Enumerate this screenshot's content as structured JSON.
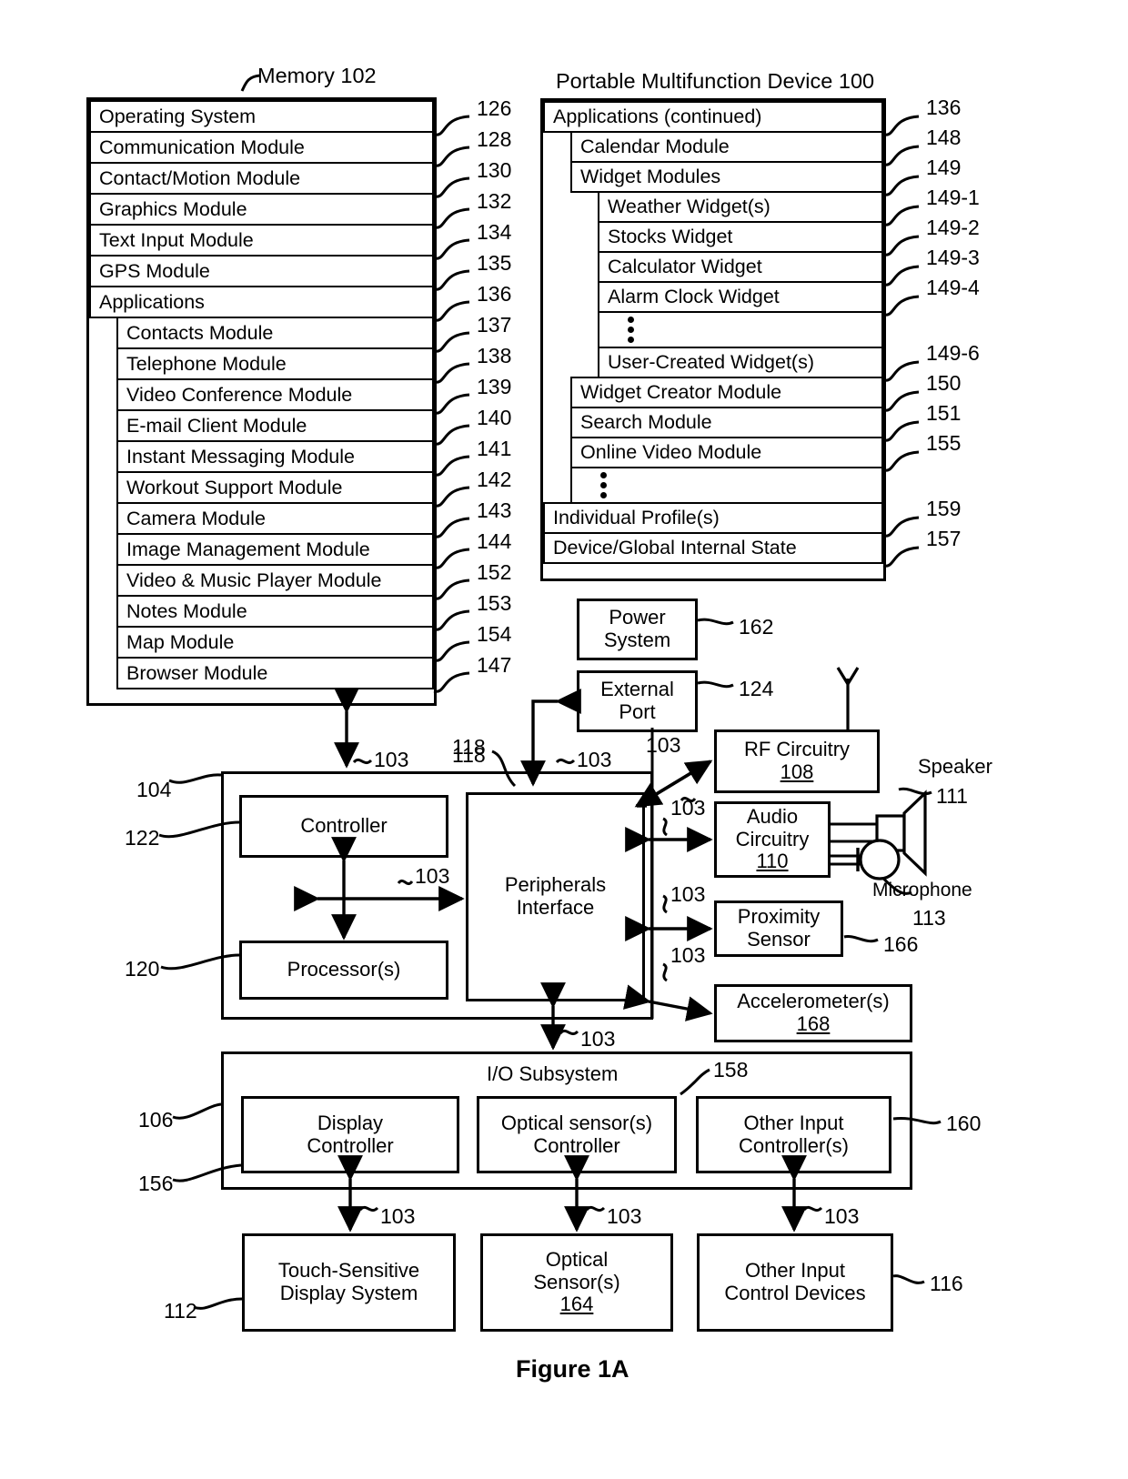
{
  "figure": {
    "caption": "Figure 1A"
  },
  "memory": {
    "title": "Memory 102",
    "rows": [
      {
        "label": "Operating System",
        "ref": "126",
        "indent": 0
      },
      {
        "label": "Communication Module",
        "ref": "128",
        "indent": 0
      },
      {
        "label": "Contact/Motion Module",
        "ref": "130",
        "indent": 0
      },
      {
        "label": "Graphics Module",
        "ref": "132",
        "indent": 0
      },
      {
        "label": "Text Input Module",
        "ref": "134",
        "indent": 0
      },
      {
        "label": "GPS Module",
        "ref": "135",
        "indent": 0
      },
      {
        "label": "Applications",
        "ref": "136",
        "indent": 0
      },
      {
        "label": "Contacts Module",
        "ref": "137",
        "indent": 1
      },
      {
        "label": "Telephone Module",
        "ref": "138",
        "indent": 1
      },
      {
        "label": "Video Conference Module",
        "ref": "139",
        "indent": 1
      },
      {
        "label": "E-mail Client Module",
        "ref": "140",
        "indent": 1
      },
      {
        "label": "Instant Messaging Module",
        "ref": "141",
        "indent": 1
      },
      {
        "label": "Workout Support Module",
        "ref": "142",
        "indent": 1
      },
      {
        "label": "Camera Module",
        "ref": "143",
        "indent": 1
      },
      {
        "label": "Image Management Module",
        "ref": "144",
        "indent": 1
      },
      {
        "label": "Video & Music Player Module",
        "ref": "152",
        "indent": 1
      },
      {
        "label": "Notes Module",
        "ref": "153",
        "indent": 1
      },
      {
        "label": "Map Module",
        "ref": "154",
        "indent": 1
      },
      {
        "label": "Browser Module",
        "ref": "147",
        "indent": 1
      }
    ]
  },
  "device": {
    "title": "Portable Multifunction Device 100",
    "rows": [
      {
        "label": "Applications (continued)",
        "ref": "136",
        "indent": 0
      },
      {
        "label": "Calendar Module",
        "ref": "148",
        "indent": 1
      },
      {
        "label": "Widget Modules",
        "ref": "149",
        "indent": 1
      },
      {
        "label": "Weather Widget(s)",
        "ref": "149-1",
        "indent": 2
      },
      {
        "label": "Stocks Widget",
        "ref": "149-2",
        "indent": 2
      },
      {
        "label": "Calculator Widget",
        "ref": "149-3",
        "indent": 2
      },
      {
        "label": "Alarm Clock Widget",
        "ref": "149-4",
        "indent": 2
      },
      {
        "label": "",
        "ref": "",
        "indent": 2,
        "ellipsis": true
      },
      {
        "label": "User-Created Widget(s)",
        "ref": "149-6",
        "indent": 2
      },
      {
        "label": "Widget Creator Module",
        "ref": "150",
        "indent": 1
      },
      {
        "label": "Search Module",
        "ref": "151",
        "indent": 1
      },
      {
        "label": "Online Video Module",
        "ref": "155",
        "indent": 1
      },
      {
        "label": "",
        "ref": "",
        "indent": 1,
        "ellipsis": true
      },
      {
        "label": "Individual Profile(s)",
        "ref": "159",
        "indent": 0
      },
      {
        "label": "Device/Global Internal State",
        "ref": "157",
        "indent": 0
      }
    ]
  },
  "blocks": {
    "power_system": {
      "line1": "Power",
      "line2": "System",
      "ref": "162"
    },
    "external_port": {
      "line1": "External",
      "line2": "Port",
      "ref": "124"
    },
    "rf_circuitry": {
      "line1": "RF Circuitry",
      "num": "108"
    },
    "audio_circuitry": {
      "line1": "Audio",
      "line2": "Circuitry",
      "num": "110"
    },
    "proximity_sensor": {
      "line1": "Proximity",
      "line2": "Sensor",
      "ref": "166"
    },
    "accelerometer": {
      "line1": "Accelerometer(s)",
      "num": "168"
    },
    "controller": {
      "label": "Controller",
      "ref": "122"
    },
    "processor": {
      "label": "Processor(s)",
      "ref": "120"
    },
    "peripherals": {
      "line1": "Peripherals",
      "line2": "Interface",
      "ref": "118"
    },
    "cpu_group_ref": "104",
    "io_subsystem": {
      "title": "I/O Subsystem",
      "ref": "158",
      "left_ref": "106",
      "inner_ref": "156"
    },
    "display_controller": {
      "line1": "Display",
      "line2": "Controller"
    },
    "optical_controller": {
      "line1": "Optical sensor(s)",
      "line2": "Controller"
    },
    "other_input_controller": {
      "line1": "Other Input",
      "line2": "Controller(s)",
      "ref": "160"
    },
    "touch_display": {
      "line1": "Touch-Sensitive",
      "line2": "Display System",
      "ref": "112"
    },
    "optical_sensor": {
      "line1": "Optical",
      "line2": "Sensor(s)",
      "num": "164"
    },
    "other_input_devices": {
      "line1": "Other Input",
      "line2": "Control Devices",
      "ref": "116"
    }
  },
  "peripherals": {
    "speaker_label": "Speaker",
    "speaker_ref": "111",
    "microphone_label": "Microphone",
    "microphone_ref": "113"
  },
  "bus_label": "103",
  "colors": {
    "ink": "#000000",
    "paper": "#ffffff"
  }
}
